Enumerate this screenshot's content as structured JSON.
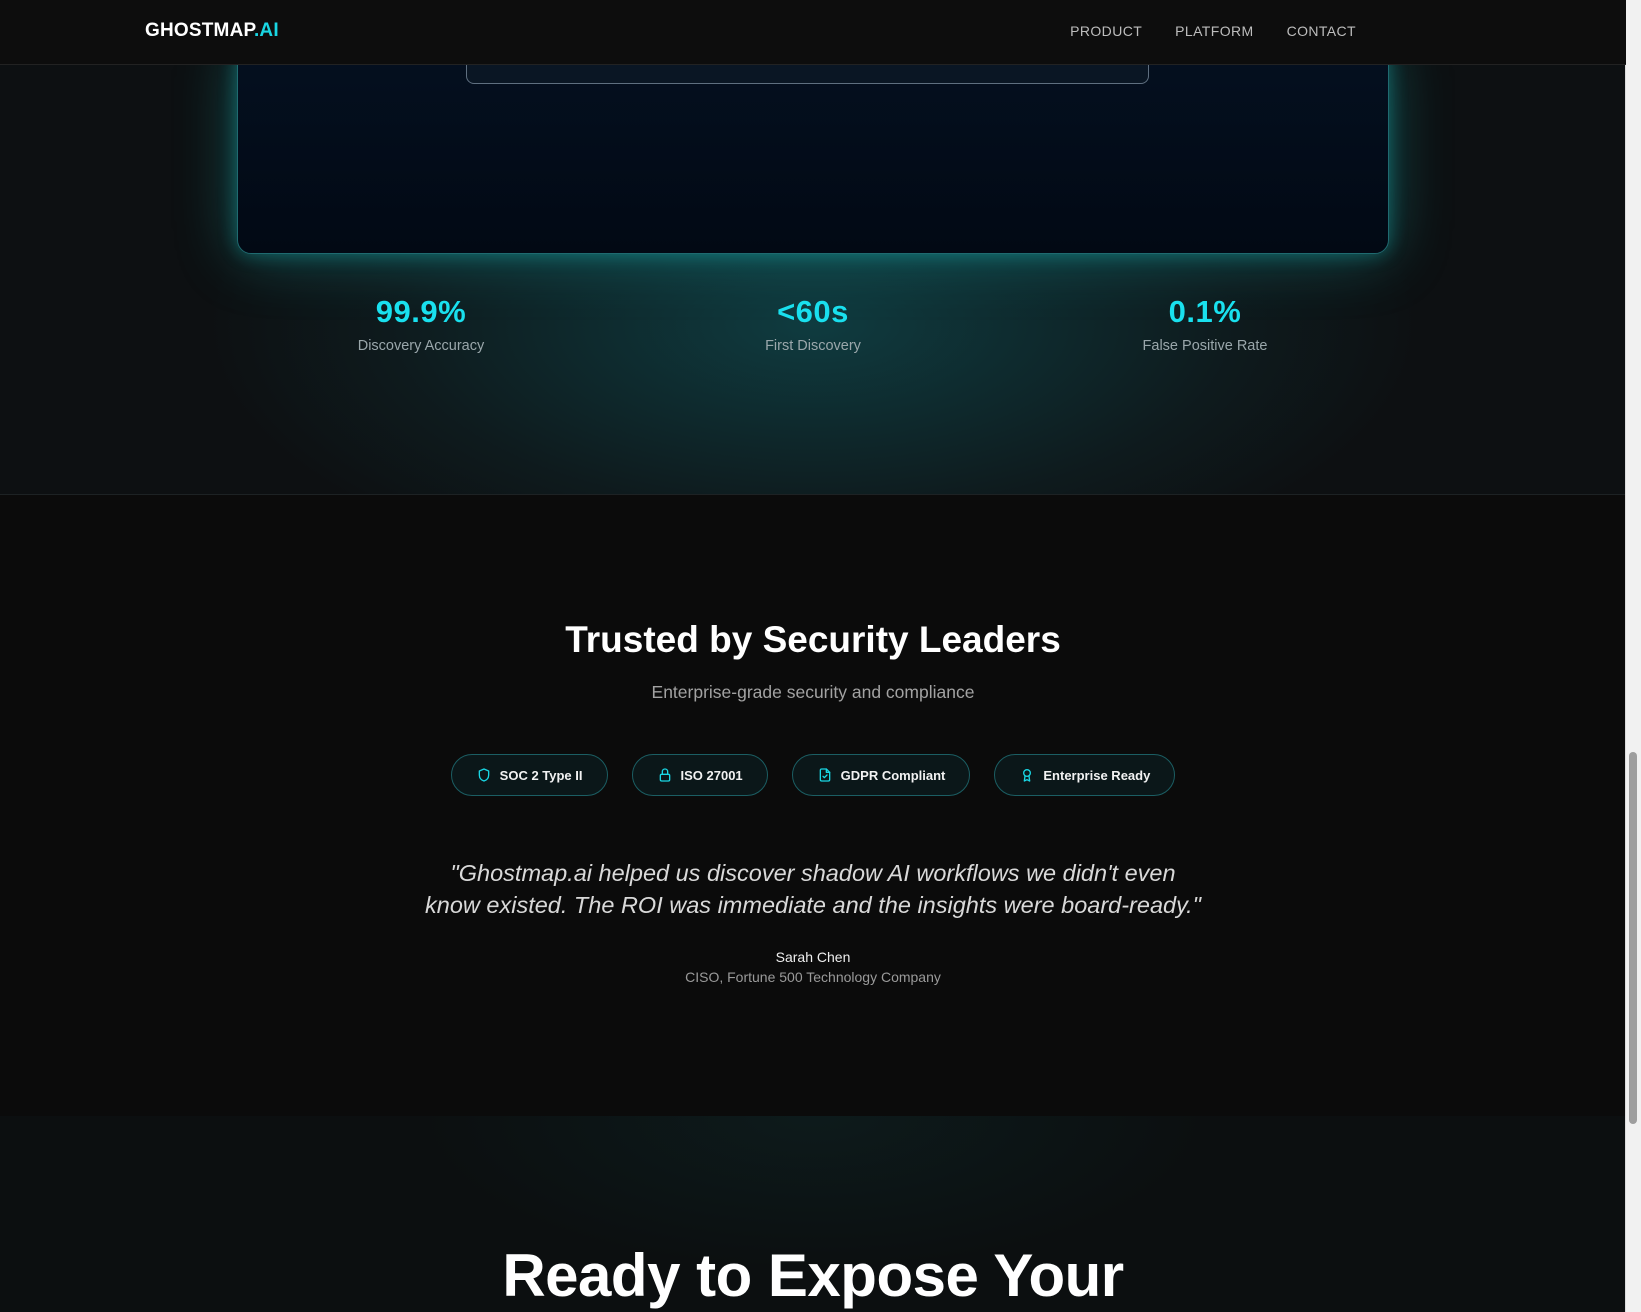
{
  "header": {
    "logo_main": "GHOSTMAP",
    "logo_accent": ".AI",
    "nav": [
      "PRODUCT",
      "PLATFORM",
      "CONTACT"
    ]
  },
  "stats": [
    {
      "value": "99.9%",
      "label": "Discovery Accuracy"
    },
    {
      "value": "<60s",
      "label": "First Discovery"
    },
    {
      "value": "0.1%",
      "label": "False Positive Rate"
    }
  ],
  "trusted": {
    "title": "Trusted by Security Leaders",
    "subtitle": "Enterprise-grade security and compliance",
    "badges": [
      {
        "label": "SOC 2 Type II",
        "icon": "shield-icon"
      },
      {
        "label": "ISO 27001",
        "icon": "lock-icon"
      },
      {
        "label": "GDPR Compliant",
        "icon": "document-check-icon"
      },
      {
        "label": "Enterprise Ready",
        "icon": "award-icon"
      }
    ],
    "quote_line1": "\"Ghostmap.ai helped us discover shadow AI workflows we didn't even",
    "quote_line2": "know existed. The ROI was immediate and the insights were board-ready.\"",
    "author": "Sarah Chen",
    "author_title": "CISO, Fortune 500 Technology Company"
  },
  "cta": {
    "title": "Ready to Expose Your"
  },
  "colors": {
    "accent": "#19d6e3",
    "background": "#0b0b0b"
  }
}
